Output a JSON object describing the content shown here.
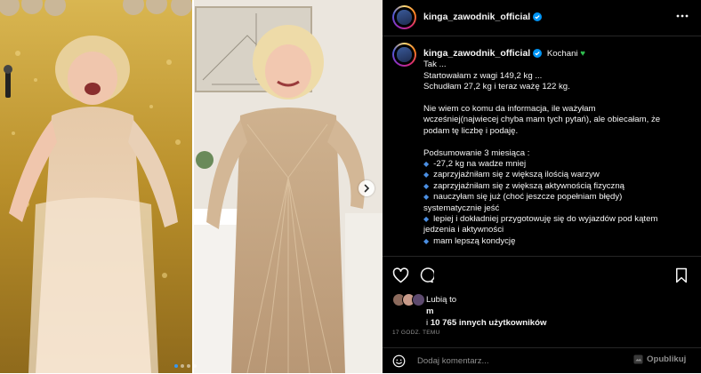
{
  "post": {
    "username": "kinga_zawodnik_official",
    "caption_greeting": "Kochani",
    "caption_lines": [
      "Tak ...",
      "Startowałam z wagi 149,2 kg ...",
      "Schudłam 27,2 kg i teraz ważę 122 kg.",
      "",
      "Nie wiem co komu da informacja, ile ważyłam",
      "wcześniej(najwiecej chyba mam tych pytań), ale obiecałam, że",
      "podam tę liczbę i podaję.",
      "",
      "Podsumowanie 3 miesiąca :"
    ],
    "bullets": [
      "-27,2 kg na wadze mniej",
      "zaprzyjaźniłam się z większą ilością warzyw",
      "zaprzyjaźniłam się z większą aktywnością fizyczną",
      "nauczyłam się już (choć jeszcze popełniam błędy)"
    ],
    "bullet_continuation": "systematycznie jeść",
    "bullets_after": [
      "lepiej i dokładniej przygotowuję się do wyjazdów pod kątem"
    ],
    "bullet_continuation_2": "jedzenia i aktywności",
    "bullets_last": [
      "mam lepszą kondycję"
    ],
    "likes_prefix": "Lubią to",
    "likes_user": "m",
    "likes_others_prefix": "i",
    "likes_others_count": "10 765 innych użytkowników",
    "time_ago": "17 GODZ. TEMU",
    "comment_placeholder": "Dodaj komentarz...",
    "post_button": "Opublikuj"
  },
  "carousel": {
    "slides": 4,
    "active_index": 0
  },
  "colors": {
    "panel_bg": "#000000",
    "verified": "#0095f6",
    "bullet": "#4b8fe3",
    "heart": "#2fbf4f",
    "muted": "#8e8e8e"
  },
  "icons": {
    "more": "more-horizontal-icon",
    "like": "heart-icon",
    "comment": "comment-bubble-icon",
    "save": "bookmark-icon",
    "emoji": "smiley-icon",
    "post": "sticker-icon"
  }
}
